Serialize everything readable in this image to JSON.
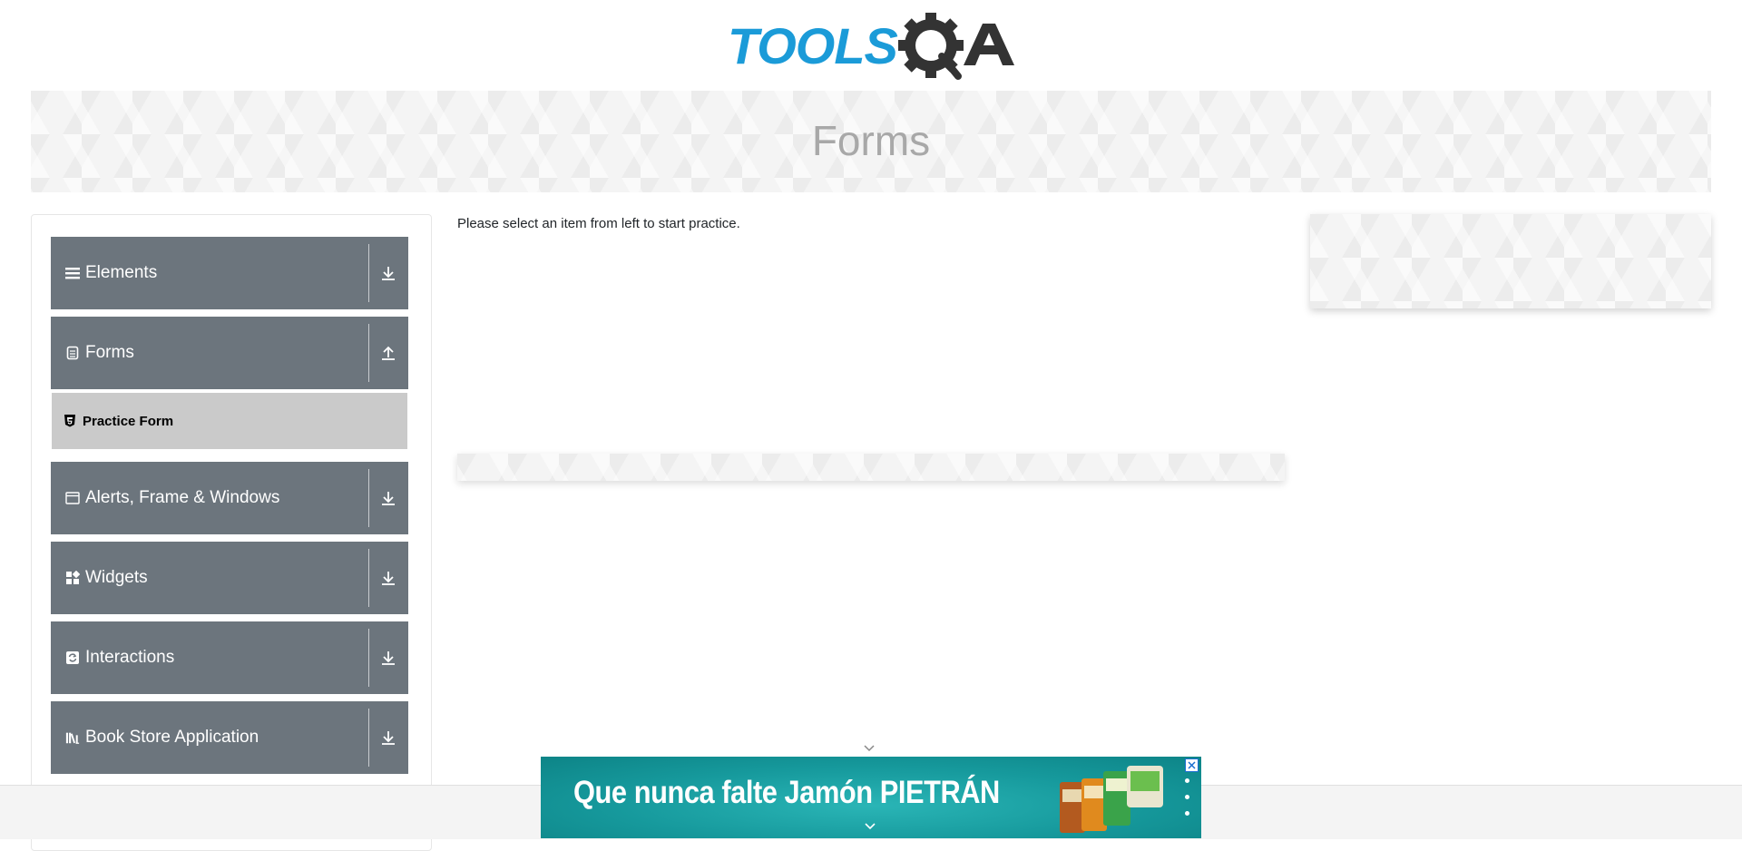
{
  "logo": {
    "part1": "TOOLS",
    "part2": "QA"
  },
  "banner": {
    "title": "Forms"
  },
  "sidebar": {
    "groups": [
      {
        "label": "Elements",
        "icon": "hamburger-icon",
        "state": "collapsed"
      },
      {
        "label": "Forms",
        "icon": "document-icon",
        "state": "expanded"
      },
      {
        "label": "Alerts, Frame & Windows",
        "icon": "window-icon",
        "state": "collapsed"
      },
      {
        "label": "Widgets",
        "icon": "widgets-icon",
        "state": "collapsed"
      },
      {
        "label": "Interactions",
        "icon": "interactions-icon",
        "state": "collapsed"
      },
      {
        "label": "Book Store Application",
        "icon": "books-icon",
        "state": "collapsed"
      }
    ],
    "forms_items": [
      {
        "label": "Practice Form",
        "icon": "html5-icon"
      }
    ]
  },
  "main": {
    "instruction": "Please select an item from left to start practice."
  },
  "ad": {
    "text": "Que nunca falte Jamón PIETRÁN"
  },
  "colors": {
    "sidebar_header": "#6c757d",
    "selected_item": "#cacaca",
    "ad_bg": "#16999c",
    "logo_blue": "#1b9bd8",
    "logo_dark": "#333333"
  }
}
